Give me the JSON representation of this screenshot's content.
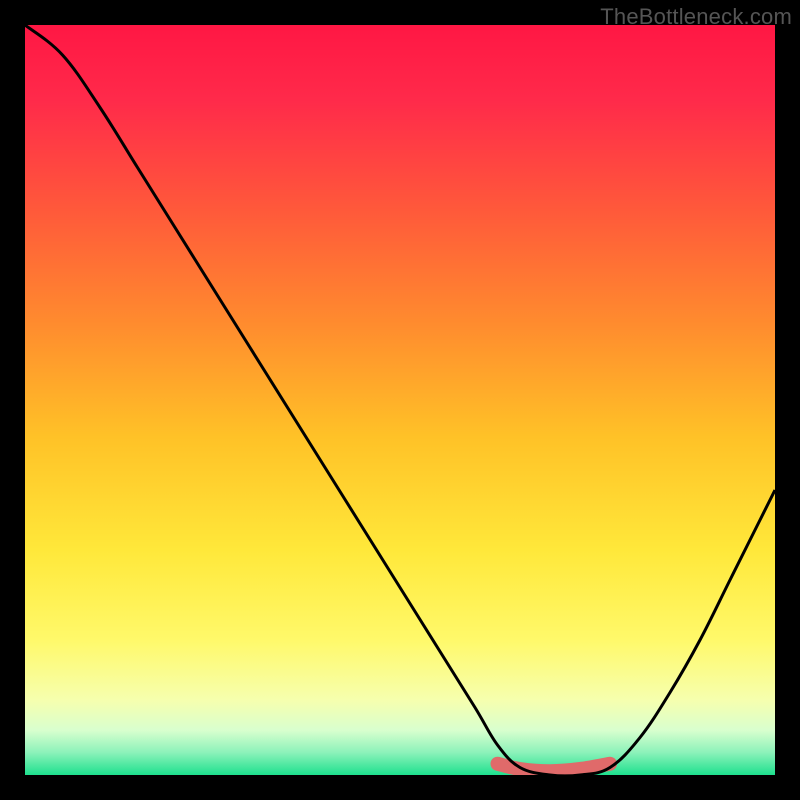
{
  "watermark": "TheBottleneck.com",
  "chart_data": {
    "type": "line",
    "title": "",
    "xlabel": "",
    "ylabel": "",
    "xlim": [
      0,
      100
    ],
    "ylim": [
      0,
      100
    ],
    "grid": false,
    "series": [
      {
        "name": "bottleneck-curve",
        "x": [
          0,
          5,
          10,
          15,
          20,
          25,
          30,
          35,
          40,
          45,
          50,
          55,
          60,
          63,
          66,
          70,
          74,
          78,
          82,
          86,
          90,
          94,
          98,
          100
        ],
        "y": [
          100,
          96,
          89,
          81,
          73,
          65,
          57,
          49,
          41,
          33,
          25,
          17,
          9,
          4,
          1,
          0,
          0,
          1,
          5,
          11,
          18,
          26,
          34,
          38
        ]
      },
      {
        "name": "optimal-zone",
        "x": [
          63,
          66,
          70,
          74,
          78
        ],
        "y": [
          1.5,
          0.8,
          0.5,
          0.8,
          1.5
        ]
      }
    ],
    "background_gradient": {
      "stops": [
        {
          "pos": 0.0,
          "color": "#ff1744"
        },
        {
          "pos": 0.1,
          "color": "#ff2a4a"
        },
        {
          "pos": 0.25,
          "color": "#ff5a3a"
        },
        {
          "pos": 0.4,
          "color": "#ff8c2e"
        },
        {
          "pos": 0.55,
          "color": "#ffc227"
        },
        {
          "pos": 0.7,
          "color": "#ffe83a"
        },
        {
          "pos": 0.82,
          "color": "#fff96a"
        },
        {
          "pos": 0.9,
          "color": "#f6ffae"
        },
        {
          "pos": 0.94,
          "color": "#d9ffce"
        },
        {
          "pos": 0.97,
          "color": "#8cf2ba"
        },
        {
          "pos": 1.0,
          "color": "#1ee08e"
        }
      ]
    },
    "colors": {
      "curve": "#000000",
      "optimal_zone": "#e06a6a"
    }
  }
}
